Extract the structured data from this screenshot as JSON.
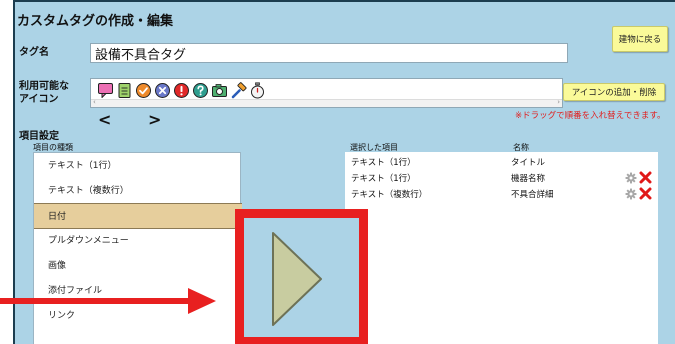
{
  "page": {
    "title": "カスタムタグの作成・編集",
    "back_button": "建物に戻る"
  },
  "tag_name": {
    "label": "タグ名",
    "value": "設備不具合タグ"
  },
  "icons": {
    "label_line1": "利用可能な",
    "label_line2": "アイコン",
    "items": [
      "pink-speech-bubble-icon",
      "green-document-icon",
      "orange-check-circle-icon",
      "blue-x-circle-icon",
      "red-exclamation-circle-icon",
      "teal-question-circle-icon",
      "camera-icon",
      "hammer-icon",
      "stopwatch-icon"
    ],
    "prev_arrow": "<",
    "next_arrow": ">",
    "add_remove_button": "アイコンの追加・削除",
    "drag_note": "※ドラッグで順番を入れ替えできます。"
  },
  "fields": {
    "section_label": "項目設定",
    "types_header": "項目の種類",
    "types": [
      "テキスト（1行）",
      "テキスト（複数行）",
      "日付",
      "プルダウンメニュー",
      "画像",
      "添付ファイル",
      "リンク"
    ],
    "selected_type_index": 2,
    "selected_header": "選択した項目",
    "name_header": "名称",
    "selected": [
      {
        "type": "テキスト（1行）",
        "name": "タイトル",
        "actions": false
      },
      {
        "type": "テキスト（1行）",
        "name": "機器名称",
        "actions": true
      },
      {
        "type": "テキスト（複数行）",
        "name": "不具合詳細",
        "actions": true
      }
    ]
  },
  "colors": {
    "frame_bg": "#acd3e6",
    "selected_row": "#e6ce9c",
    "highlight_red": "#e82020",
    "button_yellow": "#fafa99",
    "play_arrow": "#c8cca0"
  }
}
